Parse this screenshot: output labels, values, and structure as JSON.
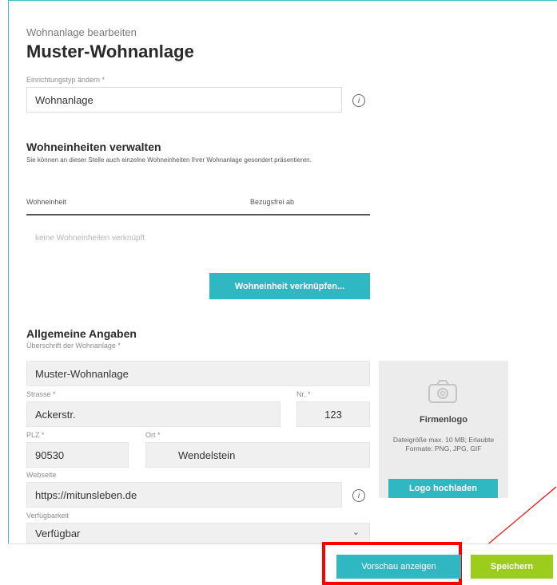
{
  "page": {
    "subtitle": "Wohnanlage bearbeiten",
    "title": "Muster-Wohnanlage"
  },
  "facility_type": {
    "label": "Einrichtungstyp ändern *",
    "value": "Wohnanlage"
  },
  "units": {
    "heading": "Wohneinheiten verwalten",
    "description": "Sie können an dieser Stelle auch einzelne Wohneinheiten Ihrer Wohnanlage gesondert präsentieren.",
    "columns": [
      "Wohneinheit",
      "Bezugsfrei ab"
    ],
    "empty_text": "keine Wohneinheiten verknüpft",
    "link_button": "Wohneinheit verknüpfen..."
  },
  "general": {
    "heading": "Allgemeine Angaben",
    "headline_label": "Überschrift der Wohnanlage *",
    "headline_value": "Muster-Wohnanlage",
    "street_label": "Strasse *",
    "street_value": "Ackerstr.",
    "nr_label": "Nr. *",
    "nr_value": "123",
    "plz_label": "PLZ *",
    "plz_value": "90530",
    "ort_label": "Ort *",
    "ort_value": "Wendelstein",
    "website_label": "Webseite",
    "website_value": "https://mitunsleben.de",
    "availability_label": "Verfügbarkeit",
    "availability_value": "Verfügbar"
  },
  "logo": {
    "title": "Firmenlogo",
    "info": "Dateigröße max. 10 MB; Erlaubte Formate: PNG, JPG, GIF",
    "upload_button": "Logo hochladen"
  },
  "footer": {
    "preview_button": "Vorschau anzeigen",
    "save_button": "Speichern"
  },
  "colors": {
    "accent": "#2fb8c1",
    "save": "#9ccc1c",
    "highlight": "#ff0000"
  }
}
